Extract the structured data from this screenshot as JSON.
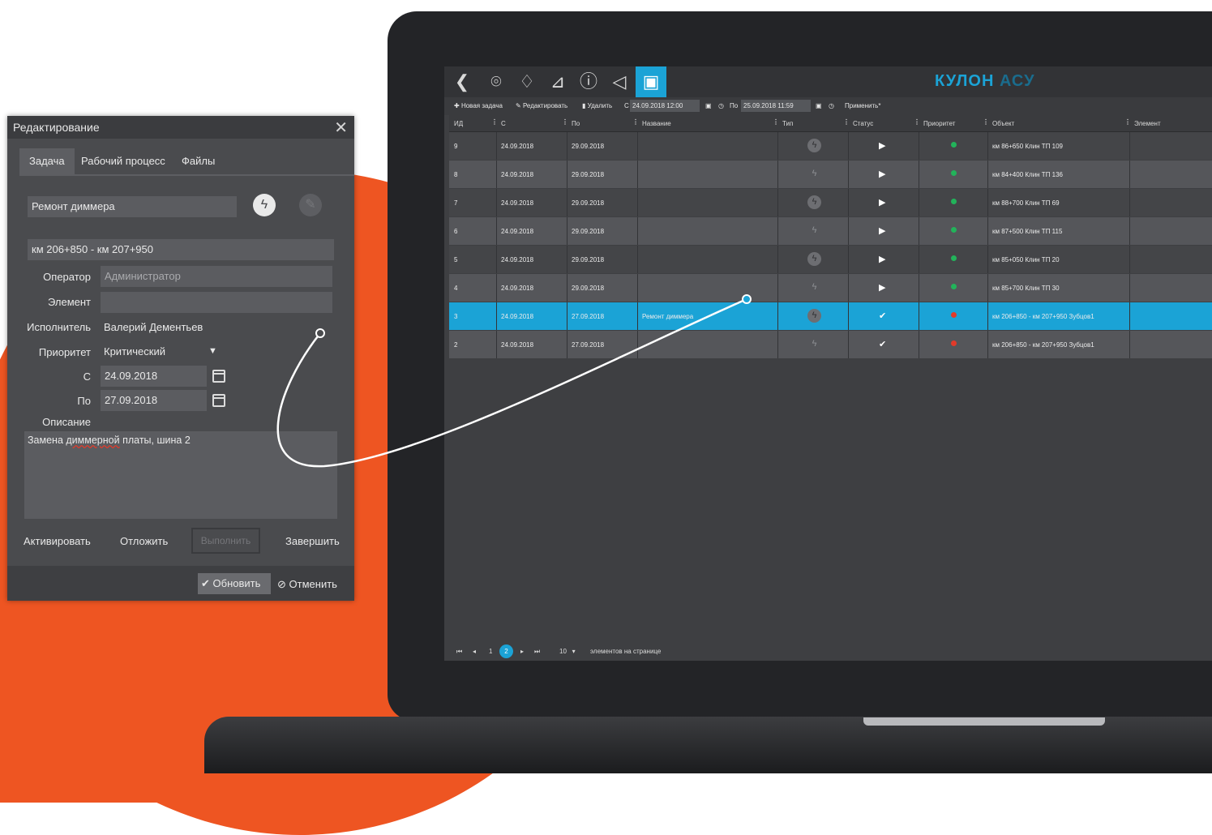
{
  "app": {
    "brand_main": "КУЛОН",
    "brand_sub": "АСУ"
  },
  "nav_icons": [
    "back-icon",
    "map-pin-icon",
    "bell-icon",
    "chart-icon",
    "info-icon",
    "megaphone-icon",
    "clipboard-icon"
  ],
  "toolbar": {
    "new_task": "Новая задача",
    "edit": "Редактировать",
    "delete": "Удалить",
    "from_label": "С",
    "from_value": "24.09.2018 12:00",
    "to_label": "По",
    "to_value": "25.09.2018 11:59",
    "apply": "Применить*"
  },
  "grid": {
    "columns": [
      "ИД",
      "С",
      "По",
      "Название",
      "Тип",
      "Статус",
      "Приоритет",
      "Объект",
      "Элемент"
    ],
    "rows": [
      {
        "id": "9",
        "from": "24.09.2018",
        "to": "29.09.2018",
        "name": "",
        "object": "км 86+650 Клин ТП 109",
        "priority": "green",
        "status": "play"
      },
      {
        "id": "8",
        "from": "24.09.2018",
        "to": "29.09.2018",
        "name": "",
        "object": "км 84+400 Клин ТП 136",
        "priority": "green",
        "status": "play"
      },
      {
        "id": "7",
        "from": "24.09.2018",
        "to": "29.09.2018",
        "name": "",
        "object": "км 88+700 Клин ТП 69",
        "priority": "green",
        "status": "play"
      },
      {
        "id": "6",
        "from": "24.09.2018",
        "to": "29.09.2018",
        "name": "",
        "object": "км 87+500 Клин ТП 115",
        "priority": "green",
        "status": "play"
      },
      {
        "id": "5",
        "from": "24.09.2018",
        "to": "29.09.2018",
        "name": "",
        "object": "км 85+050 Клин ТП 20",
        "priority": "green",
        "status": "play"
      },
      {
        "id": "4",
        "from": "24.09.2018",
        "to": "29.09.2018",
        "name": "",
        "object": "км 85+700 Клин ТП 30",
        "priority": "green",
        "status": "play"
      },
      {
        "id": "3",
        "from": "24.09.2018",
        "to": "27.09.2018",
        "name": "Ремонт диммера",
        "object": "км 206+850 - км 207+950 Зубцов1",
        "priority": "red",
        "status": "done",
        "selected": true
      },
      {
        "id": "2",
        "from": "24.09.2018",
        "to": "27.09.2018",
        "name": "",
        "object": "км 206+850 - км 207+950 Зубцов1",
        "priority": "red",
        "status": "done"
      }
    ]
  },
  "pager": {
    "first": "⏮",
    "prev": "◂",
    "page1": "1",
    "page2": "2",
    "next": "▸",
    "last": "⏭",
    "page_size": "10",
    "per_page_label": "элементов на странице"
  },
  "colors": {
    "accent": "#1ba3d6",
    "orange": "#ee5522",
    "priority_green": "#22b35a",
    "priority_red": "#e23a2a"
  },
  "dialog": {
    "title": "Редактирование",
    "tabs": [
      "Задача",
      "Рабочий процесс",
      "Файлы"
    ],
    "task_name": "Ремонт диммера",
    "location": "км 206+850 - км 207+950",
    "operator_label": "Оператор",
    "operator_value": "Администратор",
    "element_label": "Элемент",
    "element_value": "",
    "executor_label": "Исполнитель",
    "executor_value": "Валерий Дементьев",
    "priority_label": "Приоритет",
    "priority_value": "Критический",
    "from_label": "С",
    "from_value": "24.09.2018",
    "to_label": "По",
    "to_value": "27.09.2018",
    "description_label": "Описание",
    "description_pre": "Замена ",
    "description_misspelled": "диммерной",
    "description_post": " платы, шина 2",
    "actions": {
      "activate": "Активировать",
      "postpone": "Отложить",
      "execute": "Выполнить",
      "finish": "Завершить"
    },
    "update": "Обновить",
    "cancel": "Отменить"
  }
}
